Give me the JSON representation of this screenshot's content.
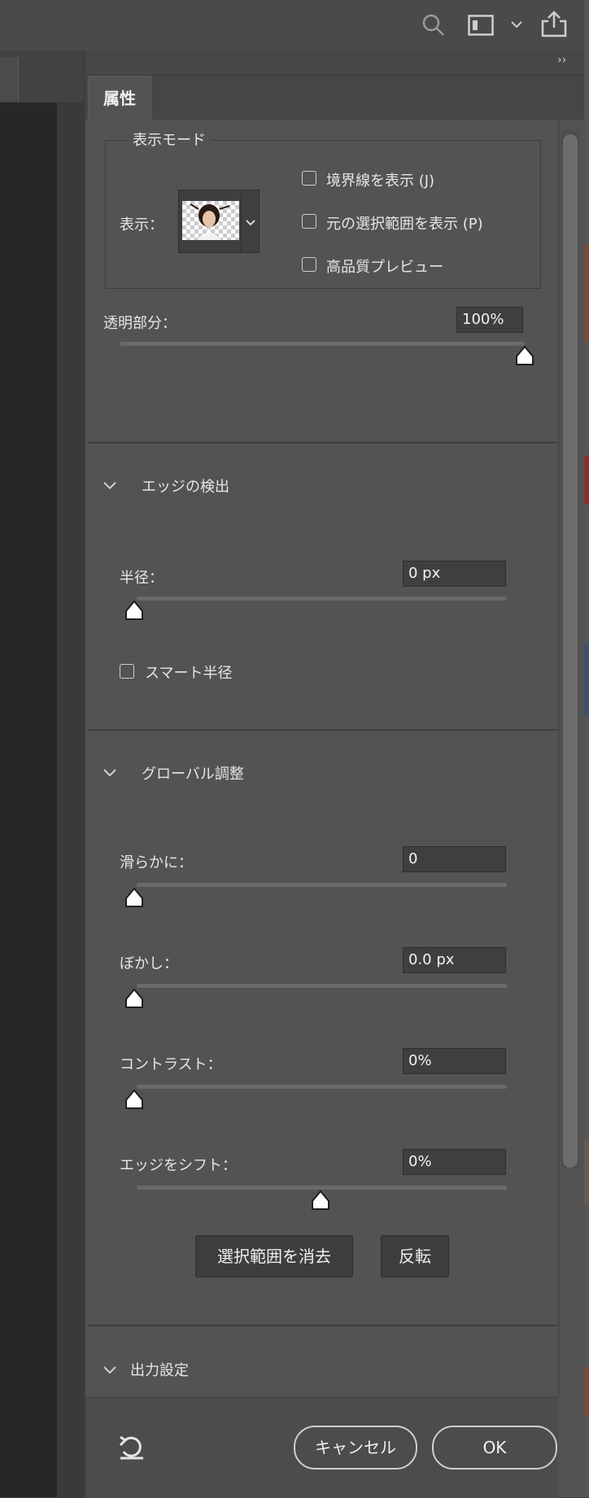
{
  "panel": {
    "tab_label": "属性",
    "collapse_glyph": "››"
  },
  "display_mode": {
    "legend": "表示モード",
    "view_label": "表示：",
    "checkboxes": [
      {
        "label": "境界線を表示 (J)",
        "checked": false
      },
      {
        "label": "元の選択範囲を表示 (P)",
        "checked": false
      },
      {
        "label": "高品質プレビュー",
        "checked": false
      }
    ],
    "transparency_label": "透明部分：",
    "transparency_value": "100%",
    "transparency_level": 1.0
  },
  "edge_detection": {
    "title": "エッジの検出",
    "radius_label": "半径：",
    "radius_value": "0 px",
    "radius_level": 0,
    "smart_radius_label": "スマート半径",
    "smart_radius_checked": false
  },
  "global_refinements": {
    "title": "グローバル調整",
    "sliders": [
      {
        "label": "滑らかに：",
        "value": "0",
        "level": 0
      },
      {
        "label": "ぼかし：",
        "value": "0.0 px",
        "level": 0
      },
      {
        "label": "コントラスト：",
        "value": "0%",
        "level": 0
      },
      {
        "label": "エッジをシフト：",
        "value": "0%",
        "level": 0.5
      }
    ],
    "clear_selection_button": "選択範囲を消去",
    "invert_button": "反転"
  },
  "output_settings": {
    "title": "出力設定"
  },
  "footer": {
    "cancel_label": "キャンセル",
    "ok_label": "OK"
  },
  "icons": {
    "search": "search-icon",
    "workspace": "workspace-icon",
    "share": "share-icon",
    "reset": "reset-icon"
  },
  "colors": {
    "panel_bg": "#535353",
    "field_bg": "#3f3f3f",
    "text": "#e6e6e6"
  }
}
